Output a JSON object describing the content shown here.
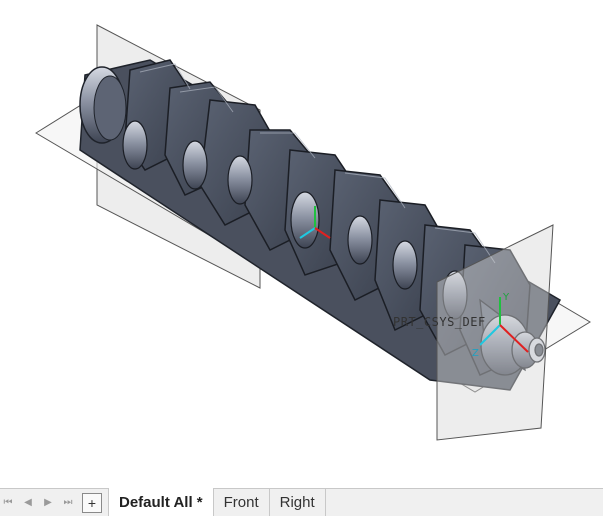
{
  "viewport": {
    "csys_label": "PRT_CSYS_DEF"
  },
  "tabbar": {
    "nav": {
      "first": "⏮",
      "prev": "◀",
      "next": "▶",
      "last": "⏭"
    },
    "add_label": "+",
    "tabs": [
      {
        "label": "Default All *",
        "active": true
      },
      {
        "label": "Front",
        "active": false
      },
      {
        "label": "Right",
        "active": false
      }
    ]
  },
  "colors": {
    "part_fill": "#6f7786",
    "part_dark": "#3b4150",
    "part_light": "#c9ced8",
    "plane_fill": "#e6e6e6",
    "axis_x": "#e02020",
    "axis_y": "#20c040",
    "axis_z": "#20c8e0"
  }
}
